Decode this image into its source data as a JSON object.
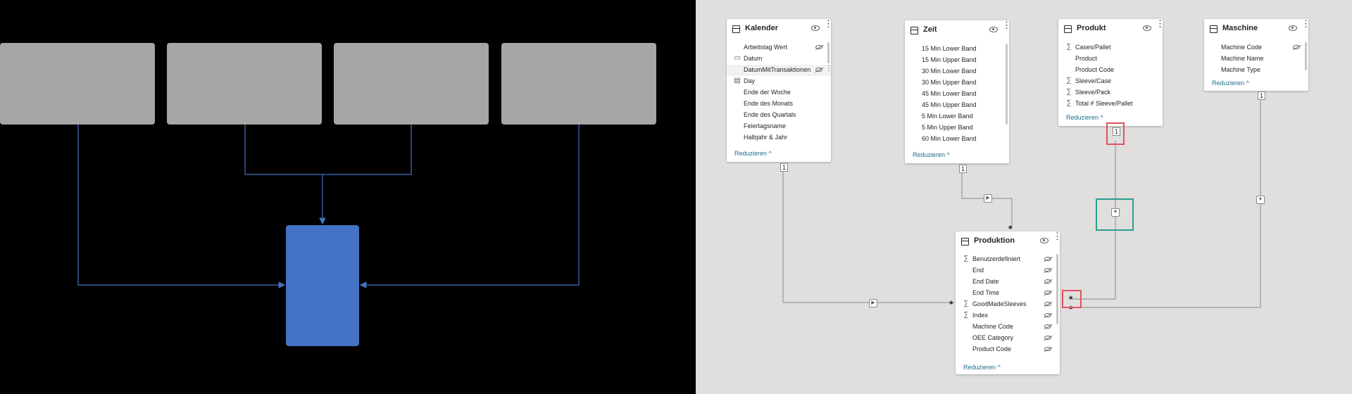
{
  "tables": {
    "kalender": {
      "title": "Kalender",
      "fields": [
        "Arbeitstag Wert",
        "Datum",
        "DatumMitTransaktionen",
        "Day",
        "Ende der Woche",
        "Ende des Monats",
        "Ende des Quartals",
        "Feiertagsname",
        "Halbjahr & Jahr"
      ],
      "reduce": "Reduzieren"
    },
    "zeit": {
      "title": "Zeit",
      "fields": [
        "15 Min Lower Band",
        "15 Min Upper Band",
        "30 Min Lower Band",
        "30 Min Upper Band",
        "45 Min Lower Band",
        "45 Min Upper Band",
        "5 Min Lower Band",
        "5 Min Upper Band",
        "60 Min Lower Band"
      ],
      "reduce": "Reduzieren"
    },
    "produkt": {
      "title": "Produkt",
      "fields": [
        "Cases/Pallet",
        "Product",
        "Product Code",
        "Sleeve/Case",
        "Sleeve/Pack",
        "Total # Sleeve/Pallet"
      ],
      "reduce": "Reduzieren"
    },
    "maschine": {
      "title": "Maschine",
      "fields": [
        "Machine Code",
        "Machine Name",
        "Machine Type"
      ],
      "reduce": "Reduzieren"
    },
    "produktion": {
      "title": "Produktion",
      "fields": [
        "Benutzerdefiniert",
        "End",
        "End Date",
        "End Time",
        "GoodMadeSleeves",
        "Index",
        "Machine Code",
        "OEE Category",
        "Product Code"
      ],
      "reduce": "Reduzieren"
    }
  },
  "cardinality": {
    "one": "1",
    "many": "*"
  },
  "colors": {
    "left_bg": "#000000",
    "gray_box": "#a6a6a6",
    "blue_box": "#4472c4",
    "connector": "#4472c4",
    "right_bg": "#e1dfdd",
    "highlight_red": "#e05260",
    "highlight_green": "#2a9d8f"
  },
  "icons": {
    "table": "table-icon",
    "visibility": "eye-icon",
    "more": "more-options-icon",
    "sum": "sigma-icon",
    "hidden": "eye-hidden-icon",
    "collapse": "chevron-up-icon",
    "filter": "filter-direction-icon"
  }
}
